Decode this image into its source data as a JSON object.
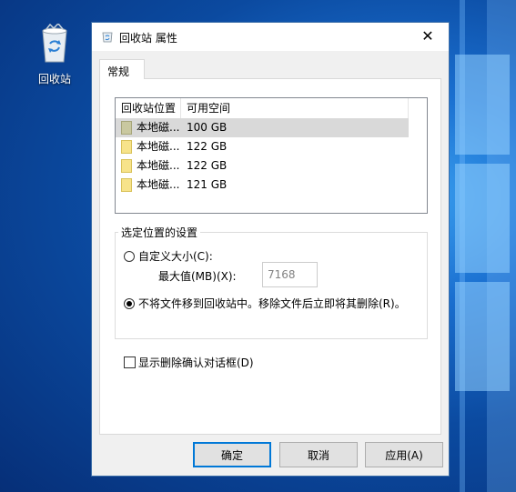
{
  "desktop": {
    "recycle_bin_label": "回收站"
  },
  "window": {
    "title": "回收站 属性",
    "close_glyph": "✕",
    "tab_label": "常规",
    "list": {
      "headers": [
        "回收站位置",
        "可用空间"
      ],
      "rows": [
        {
          "name": "本地磁...",
          "space": "100 GB",
          "selected": true
        },
        {
          "name": "本地磁...",
          "space": "122 GB",
          "selected": false
        },
        {
          "name": "本地磁...",
          "space": "122 GB",
          "selected": false
        },
        {
          "name": "本地磁...",
          "space": "121 GB",
          "selected": false
        }
      ]
    },
    "settings": {
      "group_title": "选定位置的设置",
      "custom_size_label": "自定义大小(C):",
      "max_label": "最大值(MB)(X):",
      "max_value": "7168",
      "delete_immediately_label": "不将文件移到回收站中。移除文件后立即将其删除(R)。",
      "selected_option": "delete_immediately"
    },
    "confirm_dialog_label": "显示删除确认对话框(D)",
    "confirm_checked": false,
    "buttons": {
      "ok": "确定",
      "cancel": "取消",
      "apply": "应用(A)"
    }
  },
  "colors": {
    "accent": "#0078d7",
    "desktop": "#0b4aa0"
  },
  "icons": {
    "desktop_icon": "recycle-bin-icon",
    "title_icon": "recycle-bin-icon",
    "drive_icon": "drive-icon"
  }
}
